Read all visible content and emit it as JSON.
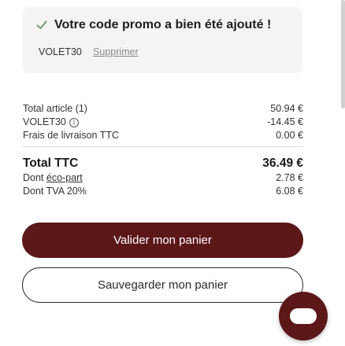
{
  "colors": {
    "accent": "#5c1718",
    "check": "#6b8f71",
    "panel": "#f4f4f2"
  },
  "promo": {
    "icon": "check-icon",
    "message": "Votre code promo a bien été ajouté !",
    "code": "VOLET30",
    "remove_label": "Supprimer"
  },
  "summary": {
    "items_label": "Total article (1)",
    "items_value": "50.94 €",
    "discount_label": "VOLET30",
    "discount_value": "-14.45 €",
    "shipping_label": "Frais de livraison TTC",
    "shipping_value": "0.00 €",
    "total_label": "Total TTC",
    "total_value": "36.49 €",
    "eco_prefix": "Dont",
    "eco_link": "éco-part",
    "eco_value": "2.78 €",
    "vat_label": "Dont TVA 20%",
    "vat_value": "6.08 €"
  },
  "actions": {
    "validate_label": "Valider mon panier",
    "save_label": "Sauvegarder mon panier",
    "chat_icon": "chat-icon"
  }
}
